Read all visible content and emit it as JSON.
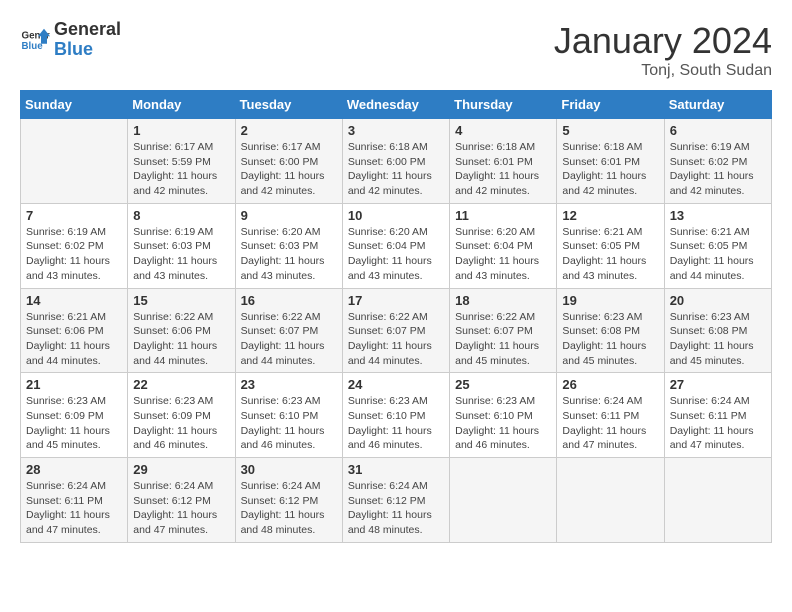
{
  "logo": {
    "line1": "General",
    "line2": "Blue"
  },
  "title": "January 2024",
  "location": "Tonj, South Sudan",
  "days_of_week": [
    "Sunday",
    "Monday",
    "Tuesday",
    "Wednesday",
    "Thursday",
    "Friday",
    "Saturday"
  ],
  "weeks": [
    [
      {
        "day": "",
        "info": ""
      },
      {
        "day": "1",
        "info": "Sunrise: 6:17 AM\nSunset: 5:59 PM\nDaylight: 11 hours and 42 minutes."
      },
      {
        "day": "2",
        "info": "Sunrise: 6:17 AM\nSunset: 6:00 PM\nDaylight: 11 hours and 42 minutes."
      },
      {
        "day": "3",
        "info": "Sunrise: 6:18 AM\nSunset: 6:00 PM\nDaylight: 11 hours and 42 minutes."
      },
      {
        "day": "4",
        "info": "Sunrise: 6:18 AM\nSunset: 6:01 PM\nDaylight: 11 hours and 42 minutes."
      },
      {
        "day": "5",
        "info": "Sunrise: 6:18 AM\nSunset: 6:01 PM\nDaylight: 11 hours and 42 minutes."
      },
      {
        "day": "6",
        "info": "Sunrise: 6:19 AM\nSunset: 6:02 PM\nDaylight: 11 hours and 42 minutes."
      }
    ],
    [
      {
        "day": "7",
        "info": "Sunrise: 6:19 AM\nSunset: 6:02 PM\nDaylight: 11 hours and 43 minutes."
      },
      {
        "day": "8",
        "info": "Sunrise: 6:19 AM\nSunset: 6:03 PM\nDaylight: 11 hours and 43 minutes."
      },
      {
        "day": "9",
        "info": "Sunrise: 6:20 AM\nSunset: 6:03 PM\nDaylight: 11 hours and 43 minutes."
      },
      {
        "day": "10",
        "info": "Sunrise: 6:20 AM\nSunset: 6:04 PM\nDaylight: 11 hours and 43 minutes."
      },
      {
        "day": "11",
        "info": "Sunrise: 6:20 AM\nSunset: 6:04 PM\nDaylight: 11 hours and 43 minutes."
      },
      {
        "day": "12",
        "info": "Sunrise: 6:21 AM\nSunset: 6:05 PM\nDaylight: 11 hours and 43 minutes."
      },
      {
        "day": "13",
        "info": "Sunrise: 6:21 AM\nSunset: 6:05 PM\nDaylight: 11 hours and 44 minutes."
      }
    ],
    [
      {
        "day": "14",
        "info": "Sunrise: 6:21 AM\nSunset: 6:06 PM\nDaylight: 11 hours and 44 minutes."
      },
      {
        "day": "15",
        "info": "Sunrise: 6:22 AM\nSunset: 6:06 PM\nDaylight: 11 hours and 44 minutes."
      },
      {
        "day": "16",
        "info": "Sunrise: 6:22 AM\nSunset: 6:07 PM\nDaylight: 11 hours and 44 minutes."
      },
      {
        "day": "17",
        "info": "Sunrise: 6:22 AM\nSunset: 6:07 PM\nDaylight: 11 hours and 44 minutes."
      },
      {
        "day": "18",
        "info": "Sunrise: 6:22 AM\nSunset: 6:07 PM\nDaylight: 11 hours and 45 minutes."
      },
      {
        "day": "19",
        "info": "Sunrise: 6:23 AM\nSunset: 6:08 PM\nDaylight: 11 hours and 45 minutes."
      },
      {
        "day": "20",
        "info": "Sunrise: 6:23 AM\nSunset: 6:08 PM\nDaylight: 11 hours and 45 minutes."
      }
    ],
    [
      {
        "day": "21",
        "info": "Sunrise: 6:23 AM\nSunset: 6:09 PM\nDaylight: 11 hours and 45 minutes."
      },
      {
        "day": "22",
        "info": "Sunrise: 6:23 AM\nSunset: 6:09 PM\nDaylight: 11 hours and 46 minutes."
      },
      {
        "day": "23",
        "info": "Sunrise: 6:23 AM\nSunset: 6:10 PM\nDaylight: 11 hours and 46 minutes."
      },
      {
        "day": "24",
        "info": "Sunrise: 6:23 AM\nSunset: 6:10 PM\nDaylight: 11 hours and 46 minutes."
      },
      {
        "day": "25",
        "info": "Sunrise: 6:23 AM\nSunset: 6:10 PM\nDaylight: 11 hours and 46 minutes."
      },
      {
        "day": "26",
        "info": "Sunrise: 6:24 AM\nSunset: 6:11 PM\nDaylight: 11 hours and 47 minutes."
      },
      {
        "day": "27",
        "info": "Sunrise: 6:24 AM\nSunset: 6:11 PM\nDaylight: 11 hours and 47 minutes."
      }
    ],
    [
      {
        "day": "28",
        "info": "Sunrise: 6:24 AM\nSunset: 6:11 PM\nDaylight: 11 hours and 47 minutes."
      },
      {
        "day": "29",
        "info": "Sunrise: 6:24 AM\nSunset: 6:12 PM\nDaylight: 11 hours and 47 minutes."
      },
      {
        "day": "30",
        "info": "Sunrise: 6:24 AM\nSunset: 6:12 PM\nDaylight: 11 hours and 48 minutes."
      },
      {
        "day": "31",
        "info": "Sunrise: 6:24 AM\nSunset: 6:12 PM\nDaylight: 11 hours and 48 minutes."
      },
      {
        "day": "",
        "info": ""
      },
      {
        "day": "",
        "info": ""
      },
      {
        "day": "",
        "info": ""
      }
    ]
  ]
}
